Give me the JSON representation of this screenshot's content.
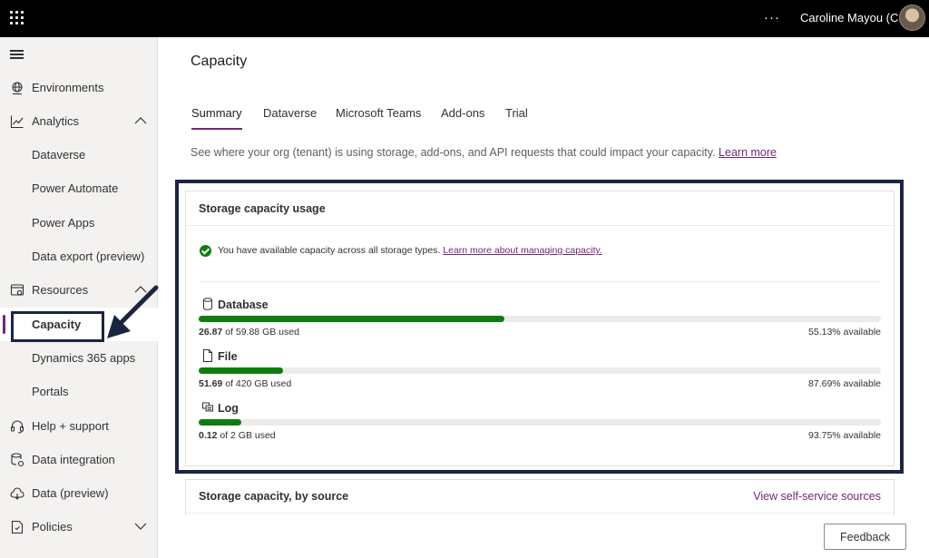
{
  "topbar": {
    "more_label": "···",
    "user_name": "Caroline Mayou (C..."
  },
  "sidebar": {
    "items": [
      {
        "label": "Environments",
        "icon": "globe-icon"
      },
      {
        "label": "Analytics",
        "icon": "chart-icon",
        "expanded": true
      },
      {
        "label": "Dataverse"
      },
      {
        "label": "Power Automate"
      },
      {
        "label": "Power Apps"
      },
      {
        "label": "Data export (preview)"
      },
      {
        "label": "Resources",
        "icon": "resources-icon",
        "expanded": true
      },
      {
        "label": "Capacity",
        "selected": true
      },
      {
        "label": "Dynamics 365 apps"
      },
      {
        "label": "Portals"
      },
      {
        "label": "Help + support",
        "icon": "headset-icon"
      },
      {
        "label": "Data integration",
        "icon": "data-integration-icon"
      },
      {
        "label": "Data (preview)",
        "icon": "cloud-data-icon"
      },
      {
        "label": "Policies",
        "icon": "policies-icon",
        "expanded": false
      }
    ]
  },
  "main": {
    "title": "Capacity",
    "tabs": [
      {
        "label": "Summary",
        "active": true
      },
      {
        "label": "Dataverse"
      },
      {
        "label": "Microsoft Teams"
      },
      {
        "label": "Add-ons"
      },
      {
        "label": "Trial"
      }
    ],
    "description": "See where your org (tenant) is using storage, add-ons, and API requests that could impact your capacity.",
    "description_link": "Learn more"
  },
  "storage_card": {
    "title": "Storage capacity usage",
    "status_text": "You have available capacity across all storage types.",
    "status_link": "Learn more about managing capacity.",
    "items": [
      {
        "name": "Database",
        "icon": "database-icon",
        "used": "26.87",
        "of_text": " of 59.88 GB used",
        "available": "55.13% available",
        "used_fraction": 0.4487
      },
      {
        "name": "File",
        "icon": "file-icon",
        "used": "51.69",
        "of_text": " of 420 GB used",
        "available": "87.69% available",
        "used_fraction": 0.1231
      },
      {
        "name": "Log",
        "icon": "log-icon",
        "used": "0.12",
        "of_text": " of 2 GB used",
        "available": "93.75% available",
        "used_fraction": 0.0625
      }
    ]
  },
  "source_card": {
    "title": "Storage capacity, by source",
    "link": "View self-service sources"
  },
  "feedback_label": "Feedback",
  "colors": {
    "accent": "#742774",
    "progress": "#107c10",
    "callout": "#1b2542"
  }
}
